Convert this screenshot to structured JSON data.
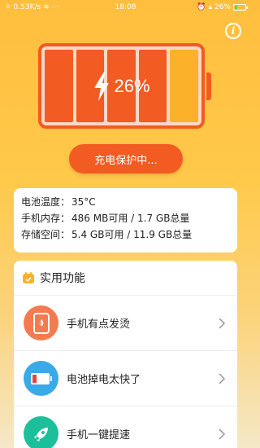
{
  "status_bar": {
    "speed": "0.53K/s",
    "time": "18:08",
    "battery_text": "26%",
    "battery_level": 0.26
  },
  "battery": {
    "percent_text": "26%",
    "cells": [
      {
        "state": "hot"
      },
      {
        "state": "hot"
      },
      {
        "state": "hot"
      },
      {
        "state": "hot"
      },
      {
        "state": "warm"
      }
    ]
  },
  "charge_button": {
    "label": "充电保护中..."
  },
  "info": {
    "temp_label": "电池温度：",
    "temp_value": "35°C",
    "memory_label": "手机内存：",
    "memory_value": "486 MB可用 / 1.7 GB总量",
    "storage_label": "存储空间：",
    "storage_value": "5.4 GB可用 / 11.9 GB总量"
  },
  "tools": {
    "title": "实用功能",
    "items": [
      {
        "label": "手机有点发烫",
        "icon": "hot-phone-icon",
        "color": "#f47b4f"
      },
      {
        "label": "电池掉电太快了",
        "icon": "low-battery-icon",
        "color": "#3aa9e8"
      },
      {
        "label": "手机一键提速",
        "icon": "rocket-icon",
        "color": "#1dbf9a"
      }
    ]
  },
  "colors": {
    "accent": "#f25b22",
    "warm_cell": "#fdb12a",
    "background_top": "#ffbe3e"
  }
}
